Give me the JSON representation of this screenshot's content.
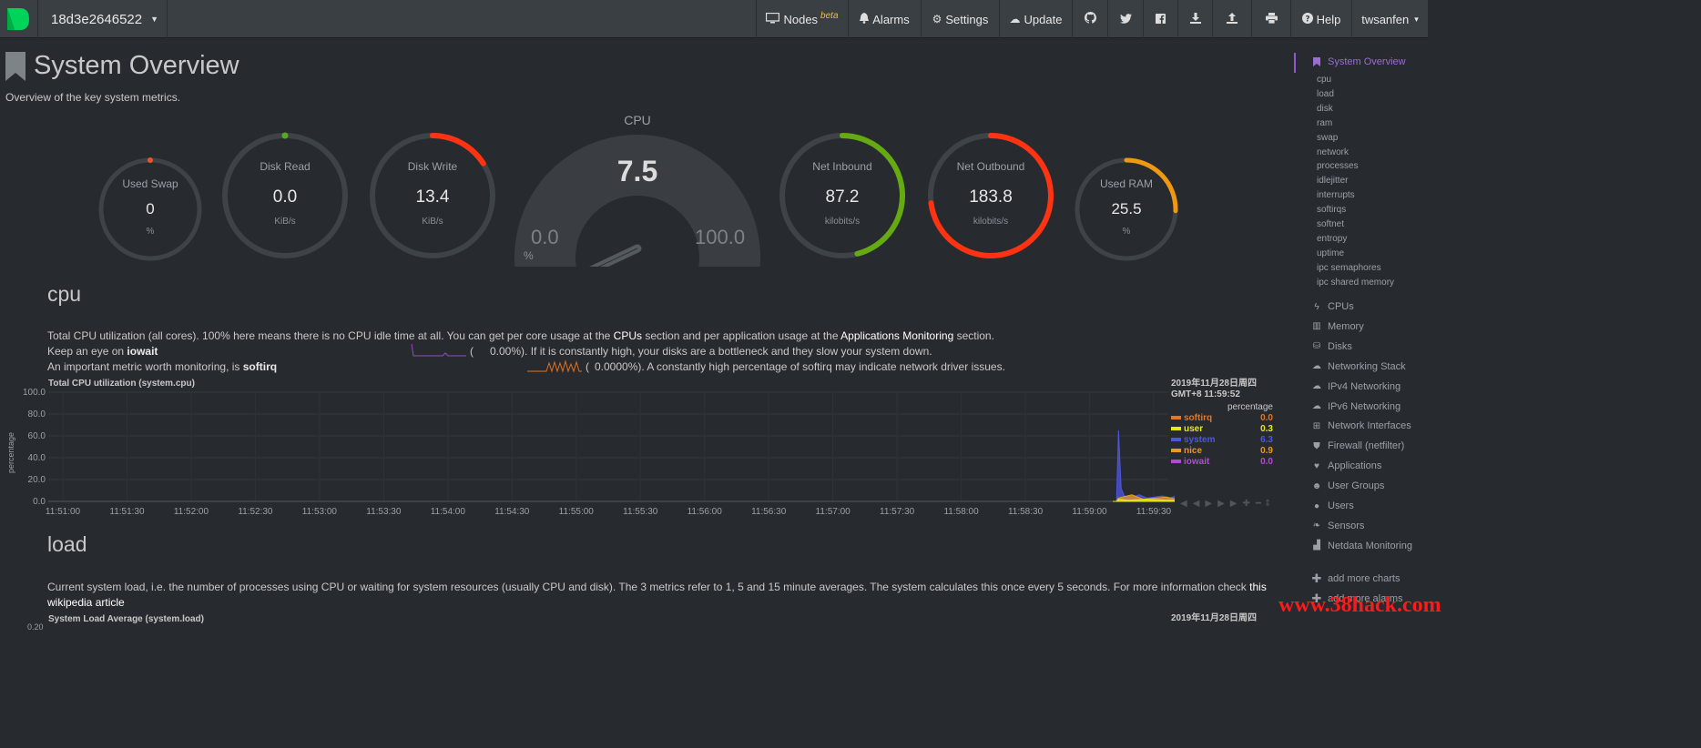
{
  "navbar": {
    "hostname": "18d3e2646522",
    "items": {
      "nodes": "Nodes",
      "nodes_badge": "beta",
      "alarms": "Alarms",
      "settings": "Settings",
      "update": "Update",
      "help": "Help",
      "user": "twsanfen"
    }
  },
  "header": {
    "title": "System Overview",
    "subtitle": "Overview of the key system metrics."
  },
  "gauges": {
    "used_swap": {
      "label": "Used Swap",
      "value": "0",
      "unit": "%",
      "color": "#ee5522",
      "fraction": 0.0
    },
    "disk_read": {
      "label": "Disk Read",
      "value": "0.0",
      "unit": "KiB/s",
      "color": "#55aa22",
      "fraction": 0.0
    },
    "disk_write": {
      "label": "Disk Write",
      "value": "13.4",
      "unit": "KiB/s",
      "color": "#ff3311",
      "fraction": 0.16
    },
    "cpu": {
      "label": "CPU",
      "value": "7.5",
      "min": "0.0",
      "max": "100.0",
      "unit": "%",
      "fraction": 0.075
    },
    "net_inbound": {
      "label": "Net Inbound",
      "value": "87.2",
      "unit": "kilobits/s",
      "color": "#66aa11",
      "fraction": 0.46
    },
    "net_outbound": {
      "label": "Net Outbound",
      "value": "183.8",
      "unit": "kilobits/s",
      "color": "#ff3311",
      "fraction": 0.73
    },
    "used_ram": {
      "label": "Used RAM",
      "value": "25.5",
      "unit": "%",
      "color": "#ee9911",
      "fraction": 0.255
    }
  },
  "cpu_section": {
    "title": "cpu",
    "line1_a": "Total CPU utilization (all cores). 100% here means there is no CPU idle time at all. You can get per core usage at the ",
    "line1_link1": "CPUs",
    "line1_b": " section and per application usage at the ",
    "line1_link2": "Applications Monitoring",
    "line1_c": " section.",
    "line2_a": "Keep an eye on ",
    "line2_strong": "iowait",
    "line2_paren": "(",
    "line2_value": "0.00%",
    "line2_b": "). If it is constantly high, your disks are a bottleneck and they slow your system down.",
    "line3_a": "An important metric worth monitoring, is ",
    "line3_strong": "softirq",
    "line3_paren": "(",
    "line3_value": "0.0000%",
    "line3_b": "). A constantly high percentage of softirq may indicate network driver issues."
  },
  "cpu_chart": {
    "title": "Total CPU utilization (system.cpu)",
    "legend_date": "2019年11月28日周四",
    "legend_time": "GMT+8 11:59:52",
    "legend_units": "percentage",
    "legend": [
      {
        "name": "softirq",
        "value": "0.0",
        "color": "#e8741c"
      },
      {
        "name": "user",
        "value": "0.3",
        "color": "#e8e81c"
      },
      {
        "name": "system",
        "value": "6.3",
        "color": "#4e56e0"
      },
      {
        "name": "nice",
        "value": "0.9",
        "color": "#e89b1c"
      },
      {
        "name": "iowait",
        "value": "0.0",
        "color": "#b548d6"
      }
    ]
  },
  "chart_data": {
    "type": "area",
    "title": "Total CPU utilization (system.cpu)",
    "xlabel": "",
    "ylabel": "percentage",
    "ylim": [
      0,
      100
    ],
    "yticks": [
      "100.0",
      "80.0",
      "60.0",
      "40.0",
      "20.0",
      "0.0"
    ],
    "x": [
      "11:51:00",
      "11:51:30",
      "11:52:00",
      "11:52:30",
      "11:53:00",
      "11:53:30",
      "11:54:00",
      "11:54:30",
      "11:55:00",
      "11:55:30",
      "11:56:00",
      "11:56:30",
      "11:57:00",
      "11:57:30",
      "11:58:00",
      "11:58:30",
      "11:59:00",
      "11:59:30"
    ],
    "series": [
      {
        "name": "system",
        "color": "#4e56e0",
        "points": [
          [
            0,
            0
          ],
          [
            1,
            0
          ],
          [
            1.5,
            65
          ],
          [
            2.2,
            12
          ],
          [
            3,
            5
          ],
          [
            5,
            4
          ],
          [
            7,
            6
          ],
          [
            9,
            3
          ],
          [
            11,
            4
          ],
          [
            13,
            5
          ],
          [
            15,
            3
          ],
          [
            17,
            6
          ]
        ]
      },
      {
        "name": "nice",
        "color": "#e89b1c",
        "points": [
          [
            0,
            0
          ],
          [
            1,
            0
          ],
          [
            1.4,
            3
          ],
          [
            2.5,
            4
          ],
          [
            5,
            6
          ],
          [
            8,
            2
          ],
          [
            11,
            3
          ],
          [
            14,
            4
          ],
          [
            17,
            2
          ]
        ]
      },
      {
        "name": "user",
        "color": "#e8e81c",
        "points": [
          [
            0,
            0
          ],
          [
            1,
            0
          ],
          [
            1.6,
            2
          ],
          [
            4,
            1
          ],
          [
            9,
            2
          ],
          [
            14,
            1
          ],
          [
            17,
            1
          ]
        ]
      }
    ]
  },
  "load_section": {
    "title": "load",
    "line1": "Current system load, i.e. the number of processes using CPU or waiting for system resources (usually CPU and disk). The 3 metrics refer to 1, 5 and 15 minute averages. The system calculates this once every 5 seconds. For more information check ",
    "link_a": "this",
    "link_b": "wikipedia article",
    "chart_title": "System Load Average (system.load)",
    "legend_date": "2019年11月28日周四",
    "ytick_top": "0.20"
  },
  "sidebar": {
    "active": "System Overview",
    "subitems": [
      "cpu",
      "load",
      "disk",
      "ram",
      "swap",
      "network",
      "processes",
      "idlejitter",
      "interrupts",
      "softirqs",
      "softnet",
      "entropy",
      "uptime",
      "ipc semaphores",
      "ipc shared memory"
    ],
    "menu": [
      {
        "label": "CPUs",
        "icon": "bolt-icon",
        "glyph": "ϟ"
      },
      {
        "label": "Memory",
        "icon": "memory-icon",
        "glyph": "▥"
      },
      {
        "label": "Disks",
        "icon": "hdd-icon",
        "glyph": "⛁"
      },
      {
        "label": "Networking Stack",
        "icon": "cloud-icon",
        "glyph": "☁"
      },
      {
        "label": "IPv4 Networking",
        "icon": "cloud-icon",
        "glyph": "☁"
      },
      {
        "label": "IPv6 Networking",
        "icon": "cloud-icon",
        "glyph": "☁"
      },
      {
        "label": "Network Interfaces",
        "icon": "sitemap-icon",
        "glyph": "⊞"
      },
      {
        "label": "Firewall (netfilter)",
        "icon": "shield-icon",
        "glyph": "⛊"
      },
      {
        "label": "Applications",
        "icon": "heartbeat-icon",
        "glyph": "♥"
      },
      {
        "label": "User Groups",
        "icon": "users-icon",
        "glyph": "☻"
      },
      {
        "label": "Users",
        "icon": "user-icon",
        "glyph": "●"
      },
      {
        "label": "Sensors",
        "icon": "leaf-icon",
        "glyph": "❧"
      },
      {
        "label": "Netdata Monitoring",
        "icon": "bar-chart-icon",
        "glyph": "▟"
      }
    ],
    "add_charts": "add more charts",
    "add_alarms": "add more alarms"
  },
  "watermark": "www.38hack.com"
}
